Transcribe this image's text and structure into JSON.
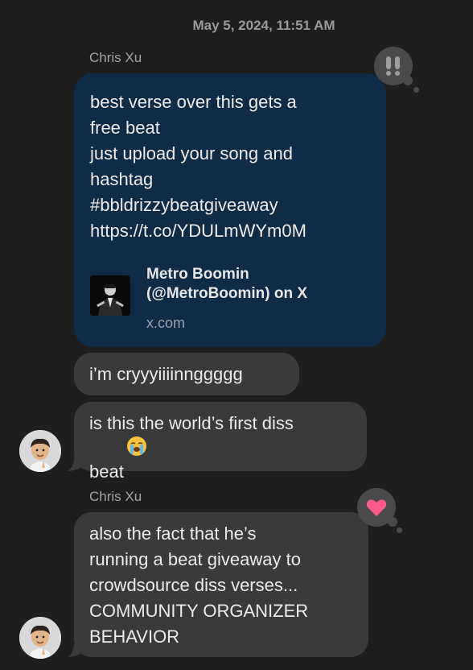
{
  "timestamp": "May 5, 2024, 11:51 AM",
  "groups": [
    {
      "sender": "Chris Xu",
      "tapback": "exclamation-icon",
      "message": {
        "text": "best verse over this gets a\nfree beat\njust upload your song and\nhashtag\n#bbldrizzybeatgiveaway\nhttps://t.co/YDULmWYm0M",
        "link_preview": {
          "title": "Metro Boomin\n(@MetroBoomin) on X",
          "domain": "x.com"
        }
      }
    }
  ],
  "messages": [
    {
      "text": "i’m cryyyiiiinnggggg"
    },
    {
      "text": "is this the world’s first diss\nbeat",
      "emoji": "loudly-crying-face-emoji"
    }
  ],
  "second_group": {
    "sender": "Chris Xu",
    "tapback": "heart-icon",
    "tapback_color": "#ff5a8c",
    "message": "also the fact that he’s\nrunning a beat giveaway to\ncrowdsource diss verses...\nCOMMUNITY ORGANIZER\nBEHAVIOR"
  },
  "colors": {
    "background": "#1e1e1e",
    "incoming_bubble": "#3a3a3c",
    "link_bubble": "#0e2b47",
    "tapback_bg": "#4a4a4c"
  }
}
